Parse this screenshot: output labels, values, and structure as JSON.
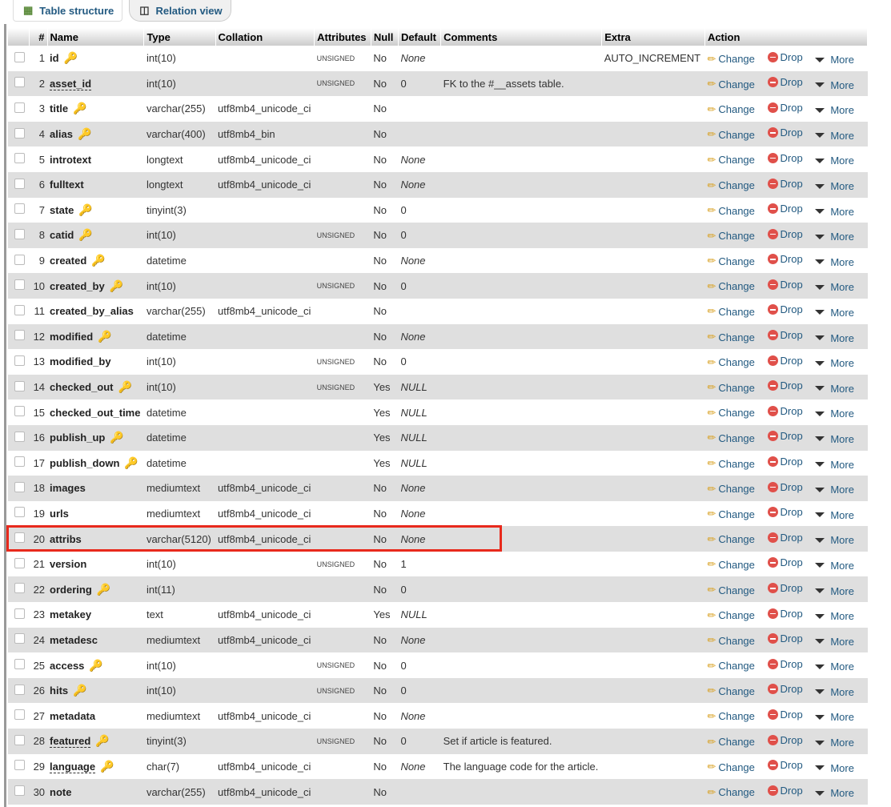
{
  "tabs": [
    {
      "label": "Table structure",
      "icon": "table-structure-icon"
    },
    {
      "label": "Relation view",
      "icon": "relation-icon"
    }
  ],
  "headers": [
    "#",
    "Name",
    "Type",
    "Collation",
    "Attributes",
    "Null",
    "Default",
    "Comments",
    "Extra",
    "Action"
  ],
  "actions": {
    "change": "Change",
    "drop": "Drop",
    "more": "More"
  },
  "highlight_row": 20,
  "rows": [
    {
      "n": "1",
      "name": "id",
      "type": "int(10)",
      "coll": "",
      "attr": "UNSIGNED",
      "null": "No",
      "def": "None",
      "comment": "",
      "extra": "AUTO_INCREMENT",
      "key": "primary"
    },
    {
      "n": "2",
      "name": "asset_id",
      "type": "int(10)",
      "coll": "",
      "attr": "UNSIGNED",
      "null": "No",
      "def": "0",
      "comment": "FK to the #__assets table.",
      "extra": "",
      "key": ""
    },
    {
      "n": "3",
      "name": "title",
      "type": "varchar(255)",
      "coll": "utf8mb4_unicode_ci",
      "attr": "",
      "null": "No",
      "def": "",
      "comment": "",
      "extra": "",
      "key": "index"
    },
    {
      "n": "4",
      "name": "alias",
      "type": "varchar(400)",
      "coll": "utf8mb4_bin",
      "attr": "",
      "null": "No",
      "def": "",
      "comment": "",
      "extra": "",
      "key": "index"
    },
    {
      "n": "5",
      "name": "introtext",
      "type": "longtext",
      "coll": "utf8mb4_unicode_ci",
      "attr": "",
      "null": "No",
      "def": "None",
      "comment": "",
      "extra": "",
      "key": ""
    },
    {
      "n": "6",
      "name": "fulltext",
      "type": "longtext",
      "coll": "utf8mb4_unicode_ci",
      "attr": "",
      "null": "No",
      "def": "None",
      "comment": "",
      "extra": "",
      "key": ""
    },
    {
      "n": "7",
      "name": "state",
      "type": "tinyint(3)",
      "coll": "",
      "attr": "",
      "null": "No",
      "def": "0",
      "comment": "",
      "extra": "",
      "key": "index"
    },
    {
      "n": "8",
      "name": "catid",
      "type": "int(10)",
      "coll": "",
      "attr": "UNSIGNED",
      "null": "No",
      "def": "0",
      "comment": "",
      "extra": "",
      "key": "index"
    },
    {
      "n": "9",
      "name": "created",
      "type": "datetime",
      "coll": "",
      "attr": "",
      "null": "No",
      "def": "None",
      "comment": "",
      "extra": "",
      "key": "index"
    },
    {
      "n": "10",
      "name": "created_by",
      "type": "int(10)",
      "coll": "",
      "attr": "UNSIGNED",
      "null": "No",
      "def": "0",
      "comment": "",
      "extra": "",
      "key": "index"
    },
    {
      "n": "11",
      "name": "created_by_alias",
      "type": "varchar(255)",
      "coll": "utf8mb4_unicode_ci",
      "attr": "",
      "null": "No",
      "def": "",
      "comment": "",
      "extra": "",
      "key": ""
    },
    {
      "n": "12",
      "name": "modified",
      "type": "datetime",
      "coll": "",
      "attr": "",
      "null": "No",
      "def": "None",
      "comment": "",
      "extra": "",
      "key": "index"
    },
    {
      "n": "13",
      "name": "modified_by",
      "type": "int(10)",
      "coll": "",
      "attr": "UNSIGNED",
      "null": "No",
      "def": "0",
      "comment": "",
      "extra": "",
      "key": ""
    },
    {
      "n": "14",
      "name": "checked_out",
      "type": "int(10)",
      "coll": "",
      "attr": "UNSIGNED",
      "null": "Yes",
      "def": "NULL",
      "comment": "",
      "extra": "",
      "key": "index"
    },
    {
      "n": "15",
      "name": "checked_out_time",
      "type": "datetime",
      "coll": "",
      "attr": "",
      "null": "Yes",
      "def": "NULL",
      "comment": "",
      "extra": "",
      "key": ""
    },
    {
      "n": "16",
      "name": "publish_up",
      "type": "datetime",
      "coll": "",
      "attr": "",
      "null": "Yes",
      "def": "NULL",
      "comment": "",
      "extra": "",
      "key": "index"
    },
    {
      "n": "17",
      "name": "publish_down",
      "type": "datetime",
      "coll": "",
      "attr": "",
      "null": "Yes",
      "def": "NULL",
      "comment": "",
      "extra": "",
      "key": "index"
    },
    {
      "n": "18",
      "name": "images",
      "type": "mediumtext",
      "coll": "utf8mb4_unicode_ci",
      "attr": "",
      "null": "No",
      "def": "None",
      "comment": "",
      "extra": "",
      "key": ""
    },
    {
      "n": "19",
      "name": "urls",
      "type": "mediumtext",
      "coll": "utf8mb4_unicode_ci",
      "attr": "",
      "null": "No",
      "def": "None",
      "comment": "",
      "extra": "",
      "key": ""
    },
    {
      "n": "20",
      "name": "attribs",
      "type": "varchar(5120)",
      "coll": "utf8mb4_unicode_ci",
      "attr": "",
      "null": "No",
      "def": "None",
      "comment": "",
      "extra": "",
      "key": ""
    },
    {
      "n": "21",
      "name": "version",
      "type": "int(10)",
      "coll": "",
      "attr": "UNSIGNED",
      "null": "No",
      "def": "1",
      "comment": "",
      "extra": "",
      "key": ""
    },
    {
      "n": "22",
      "name": "ordering",
      "type": "int(11)",
      "coll": "",
      "attr": "",
      "null": "No",
      "def": "0",
      "comment": "",
      "extra": "",
      "key": "index"
    },
    {
      "n": "23",
      "name": "metakey",
      "type": "text",
      "coll": "utf8mb4_unicode_ci",
      "attr": "",
      "null": "Yes",
      "def": "NULL",
      "comment": "",
      "extra": "",
      "key": ""
    },
    {
      "n": "24",
      "name": "metadesc",
      "type": "mediumtext",
      "coll": "utf8mb4_unicode_ci",
      "attr": "",
      "null": "No",
      "def": "None",
      "comment": "",
      "extra": "",
      "key": ""
    },
    {
      "n": "25",
      "name": "access",
      "type": "int(10)",
      "coll": "",
      "attr": "UNSIGNED",
      "null": "No",
      "def": "0",
      "comment": "",
      "extra": "",
      "key": "index"
    },
    {
      "n": "26",
      "name": "hits",
      "type": "int(10)",
      "coll": "",
      "attr": "UNSIGNED",
      "null": "No",
      "def": "0",
      "comment": "",
      "extra": "",
      "key": "index"
    },
    {
      "n": "27",
      "name": "metadata",
      "type": "mediumtext",
      "coll": "utf8mb4_unicode_ci",
      "attr": "",
      "null": "No",
      "def": "None",
      "comment": "",
      "extra": "",
      "key": ""
    },
    {
      "n": "28",
      "name": "featured",
      "type": "tinyint(3)",
      "coll": "",
      "attr": "UNSIGNED",
      "null": "No",
      "def": "0",
      "comment": "Set if article is featured.",
      "extra": "",
      "key": "index"
    },
    {
      "n": "29",
      "name": "language",
      "type": "char(7)",
      "coll": "utf8mb4_unicode_ci",
      "attr": "",
      "null": "No",
      "def": "None",
      "comment": "The language code for the article.",
      "extra": "",
      "key": "index"
    },
    {
      "n": "30",
      "name": "note",
      "type": "varchar(255)",
      "coll": "utf8mb4_unicode_ci",
      "attr": "",
      "null": "No",
      "def": "",
      "comment": "",
      "extra": "",
      "key": ""
    }
  ]
}
